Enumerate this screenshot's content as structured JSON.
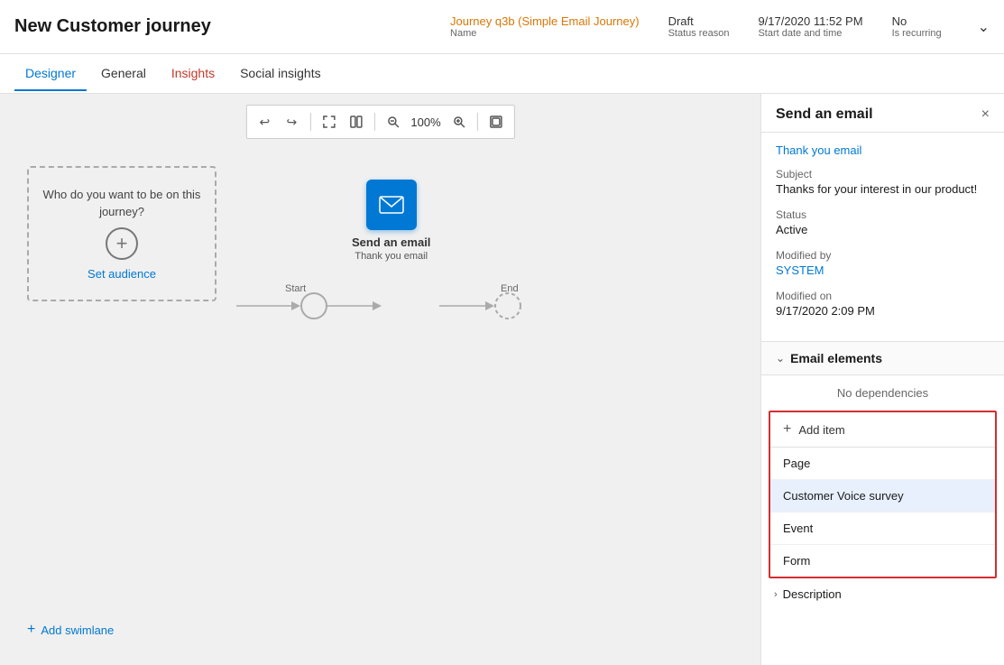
{
  "header": {
    "title": "New Customer journey",
    "meta": {
      "name_value": "Journey q3b (Simple Email Journey)",
      "name_label": "Name",
      "status_reason_value": "Draft",
      "status_reason_label": "Status reason",
      "start_date_value": "9/17/2020 11:52 PM",
      "start_date_label": "Start date and time",
      "is_recurring_value": "No",
      "is_recurring_label": "Is recurring"
    }
  },
  "tabs": {
    "items": [
      {
        "id": "designer",
        "label": "Designer",
        "active": true,
        "color": "active"
      },
      {
        "id": "general",
        "label": "General",
        "active": false,
        "color": "normal"
      },
      {
        "id": "insights",
        "label": "Insights",
        "active": false,
        "color": "red"
      },
      {
        "id": "social-insights",
        "label": "Social insights",
        "active": false,
        "color": "normal"
      }
    ]
  },
  "toolbar": {
    "undo_label": "↩",
    "redo_label": "↪",
    "expand_label": "⤢",
    "side_by_side_label": "⊞",
    "zoom_out_label": "−",
    "zoom_value": "100%",
    "zoom_in_label": "+",
    "fit_label": "⊡"
  },
  "canvas": {
    "audience_text": "Who do you want to be on this journey?",
    "set_audience_label": "Set audience",
    "add_swimlane_label": "Add swimlane",
    "start_label": "Start",
    "end_label": "End",
    "email_node": {
      "label": "Send an email",
      "sublabel": "Thank you email"
    }
  },
  "right_panel": {
    "title": "Send an email",
    "close_icon": "×",
    "email_link": "Thank you email",
    "subject_label": "Subject",
    "subject_value": "Thanks for your interest in our product!",
    "status_label": "Status",
    "status_value": "Active",
    "modified_by_label": "Modified by",
    "modified_by_value": "SYSTEM",
    "modified_on_label": "Modified on",
    "modified_on_value": "9/17/2020 2:09 PM",
    "email_elements_label": "Email elements",
    "no_dependencies": "No dependencies",
    "add_item_label": "Add item",
    "dropdown_items": [
      {
        "id": "page",
        "label": "Page",
        "highlighted": false
      },
      {
        "id": "customer-voice-survey",
        "label": "Customer Voice survey",
        "highlighted": true
      },
      {
        "id": "event",
        "label": "Event",
        "highlighted": false
      },
      {
        "id": "form",
        "label": "Form",
        "highlighted": false
      }
    ],
    "description_label": "Description"
  }
}
